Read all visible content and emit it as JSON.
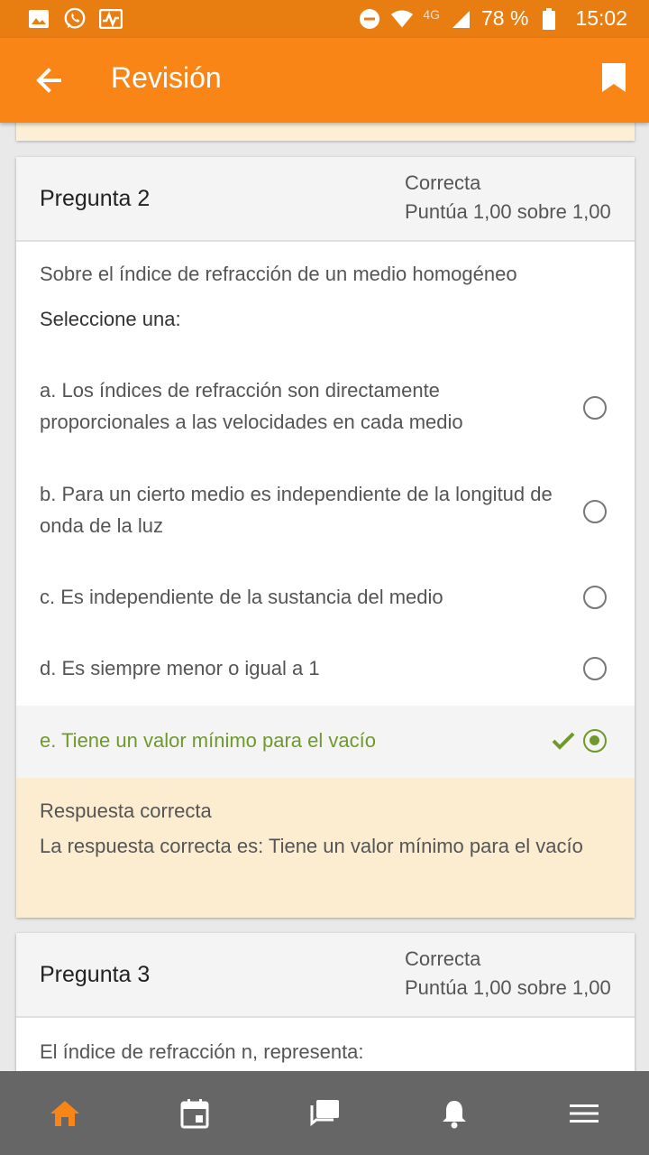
{
  "status_bar": {
    "network": "4G",
    "battery": "78 %",
    "time": "15:02"
  },
  "app_bar": {
    "title": "Revisión"
  },
  "questions": [
    {
      "title": "Pregunta 2",
      "state": "Correcta",
      "grade": "Puntúa 1,00 sobre 1,00",
      "text": "Sobre el índice de refracción de un medio homogéneo",
      "prompt": "Seleccione una:",
      "options": [
        {
          "label": "a. Los índices de refracción son directamente proporcionales a las velocidades en cada medio",
          "selected": false
        },
        {
          "label": "b. Para un cierto medio es independiente de la longitud de onda de la luz",
          "selected": false
        },
        {
          "label": "c. Es independiente de la sustancia del medio",
          "selected": false
        },
        {
          "label": "d. Es siempre menor o igual a 1",
          "selected": false
        },
        {
          "label": "e. Tiene un valor mínimo para el vacío",
          "selected": true,
          "correct": true
        }
      ],
      "feedback": {
        "title": "Respuesta correcta",
        "text": "La respuesta correcta es: Tiene un valor mínimo para el vacío"
      }
    },
    {
      "title": "Pregunta 3",
      "state": "Correcta",
      "grade": "Puntúa 1,00 sobre 1,00",
      "text": "El índice de refracción n, representa:"
    }
  ],
  "bottom_nav": [
    {
      "icon": "home-icon",
      "active": true
    },
    {
      "icon": "calendar-icon",
      "active": false
    },
    {
      "icon": "messages-icon",
      "active": false
    },
    {
      "icon": "bell-icon",
      "active": false
    },
    {
      "icon": "menu-icon",
      "active": false
    }
  ],
  "colors": {
    "accent": "#f98516",
    "status_bar": "#e87d12",
    "correct": "#6f9a2b",
    "feedback_bg": "#fdedd0"
  }
}
